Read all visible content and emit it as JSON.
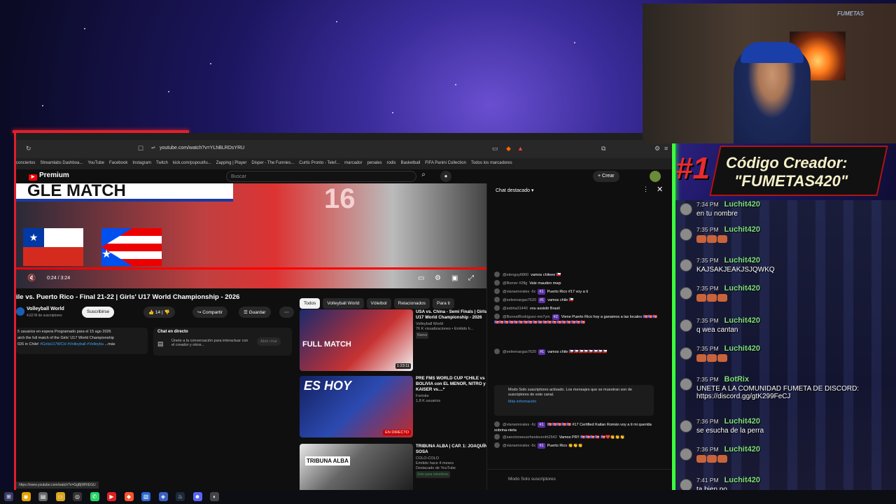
{
  "browser": {
    "url": "youtube.com/watch?v=YLhBLRDsYRU",
    "bookmarks": [
      "conciertos",
      "Streamlabs Dashboa...",
      "YouTube",
      "Facebook",
      "Instagram",
      "Twitch",
      "kick.com/popout/lu...",
      "Zapping | Player",
      "Disper - The Funnies...",
      "Curtis Pronto - Telef...",
      "marcador",
      "penales",
      "rodis",
      "Basketball",
      "FIFA Panini Collection",
      "Todos los marcadores"
    ],
    "status_url": "https://www.youtube.com/watch?v=GgBjWfXEGU"
  },
  "youtube": {
    "logo": "Premium",
    "search_placeholder": "Buscar",
    "create_label": "Crear",
    "player": {
      "banner_text": "GLE MATCH",
      "jersey": "16",
      "time": "0:24 / 3:24",
      "progress": 1.0
    },
    "video_title": "ile vs. Puerto Rico - Final 21-22 | Girls' U17 World Championship - 2026",
    "channel": {
      "name": "Volleyball World",
      "subs": "4,62 M de suscriptores",
      "subscribe": "Suscribirse"
    },
    "actions": {
      "likes": "14",
      "share": "Compartir",
      "save": "Guardar"
    },
    "description": {
      "line1": "5 usuarios en espera Programado para el 15 ago 2026",
      "line2": "atch the full match of the Girls' U17 World Championship",
      "line3": "026 in Chile!",
      "tags": "#GirlsU17WCH #Volleyball #Volleyba",
      "more": "...más"
    },
    "live_chat_card": {
      "title": "Chat en directo",
      "body": "Únete a la conversación para interactuar con el creador y otros...",
      "button": "Abrir chat"
    },
    "chips": [
      "Todos",
      "Volleyball World",
      "Vóleibol",
      "Relacionados",
      "Para ti"
    ],
    "recommendations": [
      {
        "title": "USA vs. China - Semi Finals | Girls' U17 World Championship - 2026",
        "channel": "Volleyball World",
        "meta": "76 K visualizaciones • Emitido h...",
        "badge": "Nuevo",
        "duration": "1:23:11",
        "thumb_text": "FULL MATCH"
      },
      {
        "title": "PRE FMS WORLD CUP *CHILE vs BOLIVIA con EL MENOR, NITRO y KAISER vs....*",
        "channel": "Fortnite",
        "meta": "1,8 K usuarios",
        "badge": "",
        "duration": "EN DIRECTO",
        "thumb_text": "ES HOY"
      },
      {
        "title": "TRIBUNA ALBA | CAP. 1: JOAQUÍN SOSA",
        "channel": "COLO-COLO",
        "meta": "Emitido hace 4 meses",
        "badge": "Solo para miembros",
        "extra": "Destacado de YouTube",
        "duration": "",
        "thumb_text": "TRIBUNA ALBA"
      }
    ],
    "chat": {
      "header": "Chat destacado",
      "messages": [
        {
          "user": "@elenguy6860",
          "text": "vamos chileee 🇨🇱"
        },
        {
          "user": "@Bomer #2flg",
          "text": "Vale mauden mwp"
        },
        {
          "user": "@vlanamorales -6c",
          "badge": "#1",
          "text": "Puerto Rico #17 voy a ti"
        },
        {
          "user": "@eeleenargas7620",
          "badge": "#1",
          "text": "vamos chile 🇨🇱"
        },
        {
          "user": "@sebha31440",
          "text": "vou assistir Brasil"
        },
        {
          "user": "@BunealRodriguez-me7ym",
          "badge": "#2",
          "text": "Viene Puerto Rico hoy a ganamos a las locales 🇵🇷🇵🇷🇵🇷🇵🇷🇵🇷🇵🇷🇵🇷🇵🇷🇵🇷🇵🇷🇵🇷🇵🇷🇵🇷🇵🇷🇵🇷🇵🇷🇵🇷🇵🇷🇵🇷🇵🇷🇵🇷🇵🇷"
        },
        {
          "user": "@eeleenargas7620",
          "badge": "#1",
          "text": "vamos chile 🇨🇱🇨🇱🇨🇱🇨🇱🇨🇱🇨🇱🇨🇱🇨🇱"
        },
        {
          "user": "@vlanamorales -6c",
          "badge": "#1",
          "text": "🇵🇷🇵🇷🇵🇷🇵🇷🇵🇷 #17 Certified Kailan Román voy a ti mi querida sobrina-nieta"
        },
        {
          "user": "@sanctoneeusrheeleventh2542",
          "text": "Vamos PR!! 🇵🇷🇵🇷🇵🇷🇵🇷 🇵🇷❤️👏👏👏"
        },
        {
          "user": "@vlanamorales -6c",
          "badge": "#1",
          "text": "Puerto Rico 👏👏👏"
        }
      ],
      "mode_notice": "Modo Solo suscriptores activado. Los mensajes que se muestran son de suscriptores de este canal.",
      "mode_link": "Más información",
      "input_placeholder": "Modo Solo suscriptores"
    }
  },
  "overlay": {
    "promo_rank": "#1",
    "promo_line1": "Código Creador:",
    "promo_line2": "\"FUMETAS420\"",
    "cam_logo": "FUMETAS",
    "twitch_chat": [
      {
        "time": "7:34 PM",
        "user": "Luchit420",
        "text": "en tu nombre"
      },
      {
        "time": "7:35 PM",
        "user": "Luchit420",
        "text": ""
      },
      {
        "time": "7:35 PM",
        "user": "Luchit420",
        "text": "KAJSAKJEAKJSJQWKQ"
      },
      {
        "time": "7:35 PM",
        "user": "Luchit420",
        "text": ""
      },
      {
        "time": "7:35 PM",
        "user": "Luchit420",
        "text": "q wea cantan"
      },
      {
        "time": "7:35 PM",
        "user": "Luchit420",
        "text": ""
      },
      {
        "time": "7:35 PM",
        "user": "BotRix",
        "text": "UNETE A LA COMUNIDAD FUMETA DE DISCORD: https://discord.gg/gtK299FeCJ"
      },
      {
        "time": "7:36 PM",
        "user": "Luchit420",
        "text": "se esucha de la perra"
      },
      {
        "time": "7:36 PM",
        "user": "Luchit420",
        "text": ""
      },
      {
        "time": "7:41 PM",
        "user": "Luchit420",
        "text": "ta bien po"
      }
    ]
  },
  "colors": {
    "accent_red": "#e0202a",
    "neon_green": "#3cff3c",
    "twitch_user": "#7fe07f"
  }
}
